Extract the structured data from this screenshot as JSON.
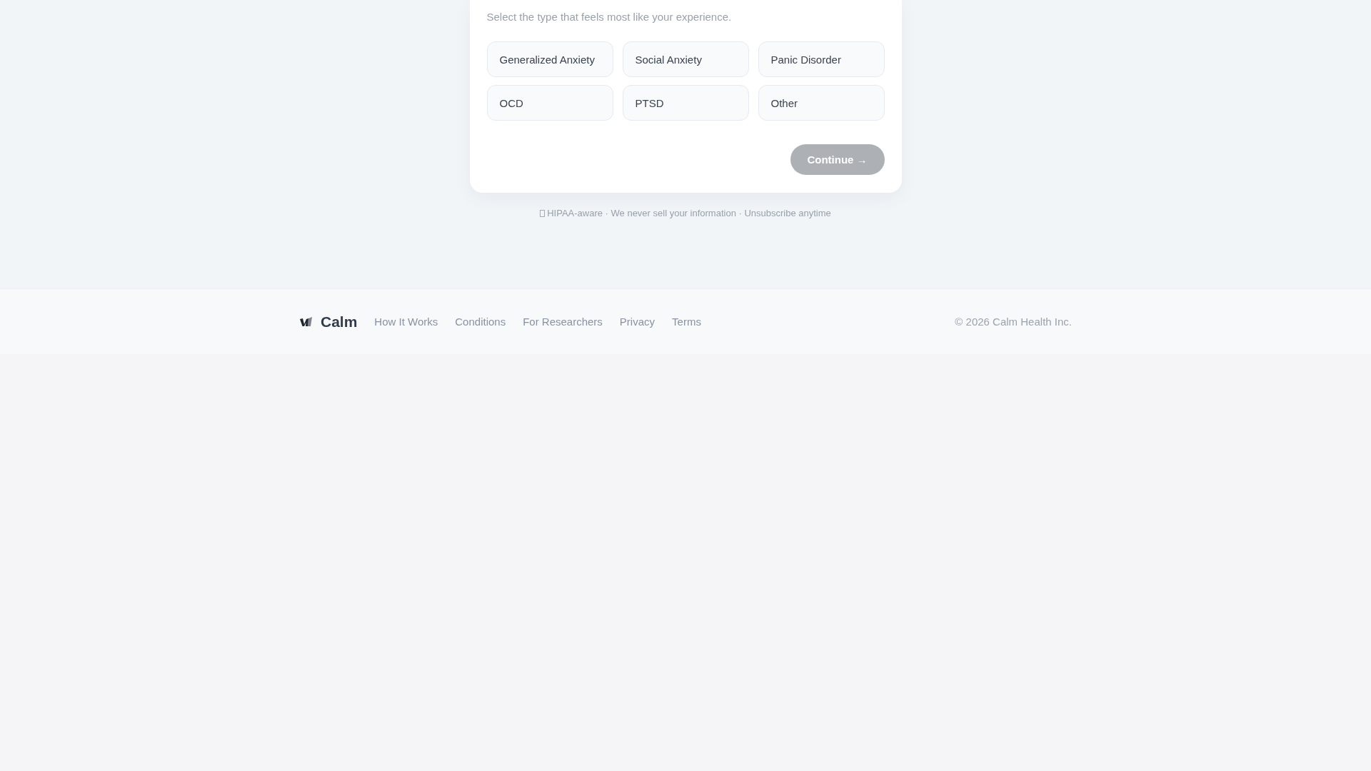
{
  "card": {
    "subtitle": "Select the type that feels most like your experience.",
    "options": [
      {
        "label": "Generalized Anxiety",
        "selected": false
      },
      {
        "label": "Social Anxiety",
        "selected": false
      },
      {
        "label": "Panic Disorder",
        "selected": false
      },
      {
        "label": "OCD",
        "selected": false
      },
      {
        "label": "PTSD",
        "selected": false
      },
      {
        "label": "Other",
        "selected": false
      }
    ],
    "continue_button": {
      "label": "Continue →",
      "disabled": true
    }
  },
  "trust_line": {
    "text": "HIPAA-aware · We never sell your information · Unsubscribe anytime"
  },
  "footer": {
    "brand": "Calm",
    "links": [
      "How It Works",
      "Conditions",
      "For Researchers",
      "Privacy",
      "Terms"
    ],
    "copyright": "© 2026 Calm Health Inc."
  }
}
